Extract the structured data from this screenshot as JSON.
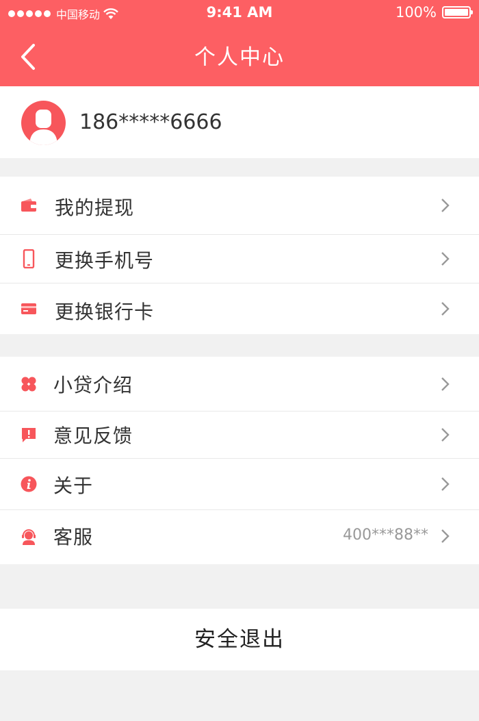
{
  "status_bar": {
    "carrier": "中国移动",
    "time": "9:41 AM",
    "battery": "100%"
  },
  "nav": {
    "title": "个人中心",
    "back_icon": "chevron-left-icon"
  },
  "profile": {
    "phone": "186*****6666",
    "avatar_icon": "user-avatar-icon"
  },
  "menu_group_1": [
    {
      "label": "我的提现",
      "icon": "wallet-icon"
    },
    {
      "label": "更换手机号",
      "icon": "phone-icon"
    },
    {
      "label": "更换银行卡",
      "icon": "bank-card-icon"
    }
  ],
  "menu_group_2": [
    {
      "label": "小贷介绍",
      "icon": "clover-icon"
    },
    {
      "label": "意见反馈",
      "icon": "feedback-icon"
    },
    {
      "label": "关于",
      "icon": "info-icon"
    },
    {
      "label": "客服",
      "icon": "customer-service-icon",
      "extra": "400***88**"
    }
  ],
  "logout": {
    "label": "安全退出"
  },
  "colors": {
    "accent": "#fd5f63",
    "icon": "#f7565b",
    "background": "#f1f1f1"
  }
}
